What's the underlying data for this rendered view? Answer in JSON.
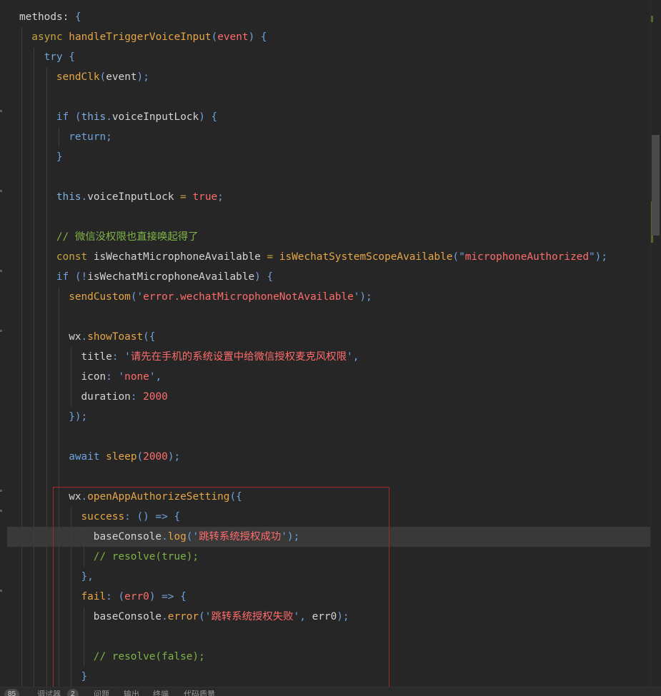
{
  "editor": {
    "lines": [
      {
        "indent": 0,
        "tokens": [
          {
            "t": "methods",
            "c": "plain"
          },
          {
            "t": ": ",
            "c": "plain"
          },
          {
            "t": "{",
            "c": "punc"
          }
        ]
      },
      {
        "indent": 1,
        "tokens": [
          {
            "t": "async ",
            "c": "kw"
          },
          {
            "t": "handleTriggerVoiceInput",
            "c": "fn"
          },
          {
            "t": "(",
            "c": "punc"
          },
          {
            "t": "event",
            "c": "str"
          },
          {
            "t": ") {",
            "c": "punc"
          }
        ]
      },
      {
        "indent": 2,
        "tokens": [
          {
            "t": "try ",
            "c": "ctl"
          },
          {
            "t": "{",
            "c": "punc"
          }
        ]
      },
      {
        "indent": 3,
        "tokens": [
          {
            "t": "sendClk",
            "c": "fn"
          },
          {
            "t": "(",
            "c": "punc"
          },
          {
            "t": "event",
            "c": "plain"
          },
          {
            "t": ");",
            "c": "punc"
          }
        ]
      },
      {
        "indent": 3,
        "tokens": []
      },
      {
        "indent": 3,
        "tokens": [
          {
            "t": "if ",
            "c": "ctl"
          },
          {
            "t": "(",
            "c": "punc"
          },
          {
            "t": "this",
            "c": "this"
          },
          {
            "t": ".",
            "c": "punc"
          },
          {
            "t": "voiceInputLock",
            "c": "plain"
          },
          {
            "t": ") {",
            "c": "punc"
          }
        ]
      },
      {
        "indent": 4,
        "tokens": [
          {
            "t": "return",
            "c": "ctl"
          },
          {
            "t": ";",
            "c": "punc"
          }
        ]
      },
      {
        "indent": 3,
        "tokens": [
          {
            "t": "}",
            "c": "punc"
          }
        ]
      },
      {
        "indent": 3,
        "tokens": []
      },
      {
        "indent": 3,
        "tokens": [
          {
            "t": "this",
            "c": "this"
          },
          {
            "t": ".",
            "c": "punc"
          },
          {
            "t": "voiceInputLock",
            "c": "plain"
          },
          {
            "t": " = ",
            "c": "kw"
          },
          {
            "t": "true",
            "c": "str"
          },
          {
            "t": ";",
            "c": "punc"
          }
        ]
      },
      {
        "indent": 3,
        "tokens": []
      },
      {
        "indent": 3,
        "tokens": [
          {
            "t": "// 微信没权限也直接唤起得了",
            "c": "cmt"
          }
        ]
      },
      {
        "indent": 3,
        "tokens": [
          {
            "t": "const ",
            "c": "kw"
          },
          {
            "t": "isWechatMicrophoneAvailable",
            "c": "plain"
          },
          {
            "t": " = ",
            "c": "kw"
          },
          {
            "t": "isWechatSystemScopeAvailable",
            "c": "fn"
          },
          {
            "t": "(\"",
            "c": "punc"
          },
          {
            "t": "microphoneAuthorized",
            "c": "str"
          },
          {
            "t": "\");",
            "c": "punc"
          }
        ]
      },
      {
        "indent": 3,
        "tokens": [
          {
            "t": "if ",
            "c": "ctl"
          },
          {
            "t": "(!",
            "c": "punc"
          },
          {
            "t": "isWechatMicrophoneAvailable",
            "c": "plain"
          },
          {
            "t": ") {",
            "c": "punc"
          }
        ]
      },
      {
        "indent": 4,
        "tokens": [
          {
            "t": "sendCustom",
            "c": "fn"
          },
          {
            "t": "('",
            "c": "punc"
          },
          {
            "t": "error.wechatMicrophoneNotAvailable",
            "c": "str"
          },
          {
            "t": "');",
            "c": "punc"
          }
        ]
      },
      {
        "indent": 4,
        "tokens": []
      },
      {
        "indent": 4,
        "tokens": [
          {
            "t": "wx",
            "c": "plain"
          },
          {
            "t": ".",
            "c": "punc"
          },
          {
            "t": "showToast",
            "c": "fn"
          },
          {
            "t": "({",
            "c": "punc"
          }
        ]
      },
      {
        "indent": 5,
        "tokens": [
          {
            "t": "title",
            "c": "plain"
          },
          {
            "t": ": '",
            "c": "punc"
          },
          {
            "t": "请先在手机的系统设置中给微信授权麦克风权限",
            "c": "str"
          },
          {
            "t": "',",
            "c": "punc"
          }
        ]
      },
      {
        "indent": 5,
        "tokens": [
          {
            "t": "icon",
            "c": "plain"
          },
          {
            "t": ": '",
            "c": "punc"
          },
          {
            "t": "none",
            "c": "str"
          },
          {
            "t": "',",
            "c": "punc"
          }
        ]
      },
      {
        "indent": 5,
        "tokens": [
          {
            "t": "duration",
            "c": "plain"
          },
          {
            "t": ": ",
            "c": "punc"
          },
          {
            "t": "2000",
            "c": "num"
          }
        ]
      },
      {
        "indent": 4,
        "tokens": [
          {
            "t": "});",
            "c": "punc"
          }
        ]
      },
      {
        "indent": 4,
        "tokens": []
      },
      {
        "indent": 4,
        "tokens": [
          {
            "t": "await ",
            "c": "ctl"
          },
          {
            "t": "sleep",
            "c": "fn"
          },
          {
            "t": "(",
            "c": "punc"
          },
          {
            "t": "2000",
            "c": "num"
          },
          {
            "t": ");",
            "c": "punc"
          }
        ]
      },
      {
        "indent": 4,
        "tokens": []
      },
      {
        "indent": 4,
        "tokens": [
          {
            "t": "wx",
            "c": "plain"
          },
          {
            "t": ".",
            "c": "punc"
          },
          {
            "t": "openAppAuthorizeSetting",
            "c": "fn"
          },
          {
            "t": "({",
            "c": "punc"
          }
        ]
      },
      {
        "indent": 5,
        "tokens": [
          {
            "t": "success",
            "c": "fn"
          },
          {
            "t": ": () => {",
            "c": "punc"
          }
        ]
      },
      {
        "indent": 6,
        "tokens": [
          {
            "t": "baseConsole",
            "c": "plain"
          },
          {
            "t": ".",
            "c": "punc"
          },
          {
            "t": "log",
            "c": "fn"
          },
          {
            "t": "('",
            "c": "punc"
          },
          {
            "t": "跳转系统授权成功",
            "c": "str"
          },
          {
            "t": "');",
            "c": "punc"
          }
        ]
      },
      {
        "indent": 6,
        "tokens": [
          {
            "t": "// resolve(true);",
            "c": "cmt"
          }
        ]
      },
      {
        "indent": 5,
        "tokens": [
          {
            "t": "},",
            "c": "punc"
          }
        ]
      },
      {
        "indent": 5,
        "tokens": [
          {
            "t": "fail",
            "c": "fn"
          },
          {
            "t": ": (",
            "c": "punc"
          },
          {
            "t": "err0",
            "c": "str"
          },
          {
            "t": ") => {",
            "c": "punc"
          }
        ]
      },
      {
        "indent": 6,
        "tokens": [
          {
            "t": "baseConsole",
            "c": "plain"
          },
          {
            "t": ".",
            "c": "punc"
          },
          {
            "t": "error",
            "c": "fn"
          },
          {
            "t": "('",
            "c": "punc"
          },
          {
            "t": "跳转系统授权失败",
            "c": "str"
          },
          {
            "t": "', ",
            "c": "punc"
          },
          {
            "t": "err0",
            "c": "plain"
          },
          {
            "t": ");",
            "c": "punc"
          }
        ]
      },
      {
        "indent": 6,
        "tokens": []
      },
      {
        "indent": 6,
        "tokens": [
          {
            "t": "// resolve(false);",
            "c": "cmt"
          }
        ]
      },
      {
        "indent": 5,
        "tokens": [
          {
            "t": "}",
            "c": "punc"
          }
        ]
      }
    ],
    "colors": {
      "background": "#262626",
      "current_line": "#393939",
      "selection_border": "#a02a2a",
      "keyword": "#c7a33e",
      "function": "#e6a646",
      "string": "#ff6c6c",
      "comment": "#7fb347",
      "control": "#6fa3dc"
    }
  },
  "statusbar": {
    "line_count": "85",
    "debugger_label": "调试器",
    "debugger_badge": "2",
    "problems_label": "问题",
    "output_label": "输出",
    "terminal_label": "终端",
    "code_quality_label": "代码质量"
  }
}
